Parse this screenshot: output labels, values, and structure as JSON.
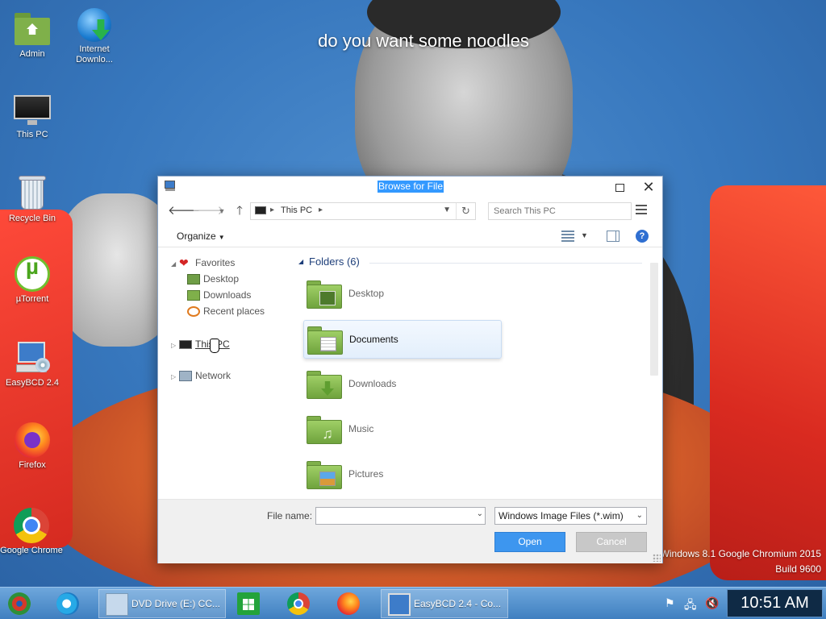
{
  "wallpaper": {
    "caption": "do you want some noodles",
    "watermark_line1": "Windows 8.1 Google Chromium 2015",
    "watermark_line2": "Build 9600"
  },
  "desktop_icons": [
    {
      "label": "Admin",
      "icon": "user-folder-icon"
    },
    {
      "label": "Internet Downlo...",
      "icon": "internet-download-manager-icon"
    },
    {
      "label": "This PC",
      "icon": "monitor-icon"
    },
    {
      "label": "Recycle Bin",
      "icon": "recycle-bin-icon"
    },
    {
      "label": "µTorrent",
      "icon": "utorrent-icon"
    },
    {
      "label": "EasyBCD 2.4",
      "icon": "easybcd-icon"
    },
    {
      "label": "Firefox",
      "icon": "firefox-icon"
    },
    {
      "label": "Google Chrome",
      "icon": "chrome-icon"
    }
  ],
  "dialog": {
    "title": "Browse for File",
    "address": {
      "path": "This PC"
    },
    "search": {
      "placeholder": "Search This PC"
    },
    "organize_label": "Organize",
    "nav": {
      "favorites": "Favorites",
      "desktop": "Desktop",
      "downloads": "Downloads",
      "recent": "Recent places",
      "thispc": "This PC",
      "network": "Network"
    },
    "group_title": "Folders (6)",
    "folders": [
      {
        "label": "Desktop",
        "selected": false
      },
      {
        "label": "Documents",
        "selected": true
      },
      {
        "label": "Downloads",
        "selected": false
      },
      {
        "label": "Music",
        "selected": false
      },
      {
        "label": "Pictures",
        "selected": false
      }
    ],
    "file_name_label": "File name:",
    "file_name_value": "",
    "filter": "Windows Image Files (*.wim)",
    "open_label": "Open",
    "cancel_label": "Cancel"
  },
  "taskbar": {
    "items": [
      {
        "label": "",
        "icon": "dvd-autorun-icon"
      },
      {
        "label": "",
        "icon": "internet-explorer-icon"
      },
      {
        "label": "DVD Drive (E:) CC...",
        "icon": "dvd-drive-icon"
      },
      {
        "label": "",
        "icon": "windows-store-icon"
      },
      {
        "label": "",
        "icon": "chrome-icon"
      },
      {
        "label": "",
        "icon": "firefox-icon"
      },
      {
        "label": "EasyBCD 2.4 - Co...",
        "icon": "easybcd-icon"
      }
    ],
    "clock": "10:51 AM"
  },
  "colors": {
    "accent": "#3399ff",
    "open_button": "#3d96ef",
    "taskbar": "#4f8fcd",
    "group_title": "#1e3f7a"
  }
}
